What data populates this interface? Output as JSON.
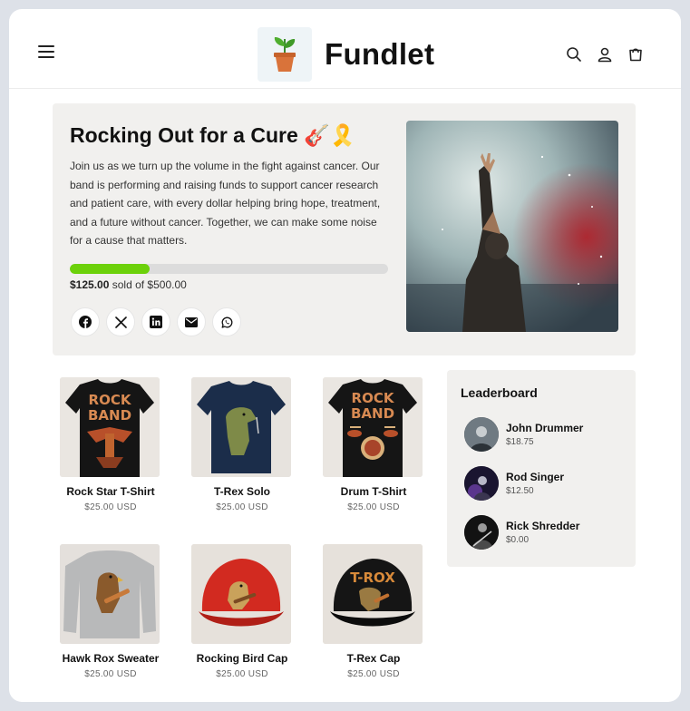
{
  "header": {
    "brand": "Fundlet",
    "icons": [
      "menu-icon",
      "search-icon",
      "account-icon",
      "cart-icon"
    ]
  },
  "campaign": {
    "title": "Rocking Out for a Cure 🎸🎗️",
    "description": "Join us as we turn up the volume in the fight against cancer. Our band is performing and raising funds to support cancer research and patient care, with every dollar helping bring hope, treatment, and a future without cancer. Together, we can make some noise for a cause that matters.",
    "raised": "$125.00",
    "sold_text": "sold of $500.00",
    "progress_fraction": 0.25,
    "progress_color": "#6cd10a",
    "share_icons": [
      "facebook-icon",
      "x-icon",
      "linkedin-icon",
      "email-icon",
      "whatsapp-icon"
    ]
  },
  "products": [
    {
      "name": "Rock Star T-Shirt",
      "price": "$25.00 USD",
      "image": "rock-band-eagle-tshirt"
    },
    {
      "name": "T-Rex Solo",
      "price": "$25.00 USD",
      "image": "trex-singer-tshirt"
    },
    {
      "name": "Drum T-Shirt",
      "price": "$25.00 USD",
      "image": "rock-band-drums-tshirt"
    },
    {
      "name": "Hawk Rox Sweater",
      "price": "$25.00 USD",
      "image": "hawk-guitar-sweater"
    },
    {
      "name": "Rocking Bird Cap",
      "price": "$25.00 USD",
      "image": "red-bird-cap"
    },
    {
      "name": "T-Rex Cap",
      "price": "$25.00 USD",
      "image": "trex-cap"
    }
  ],
  "leaderboard": {
    "title": "Leaderboard",
    "entries": [
      {
        "name": "John Drummer",
        "amount": "$18.75"
      },
      {
        "name": "Rod Singer",
        "amount": "$12.50"
      },
      {
        "name": "Rick Shredder",
        "amount": "$0.00"
      }
    ]
  }
}
